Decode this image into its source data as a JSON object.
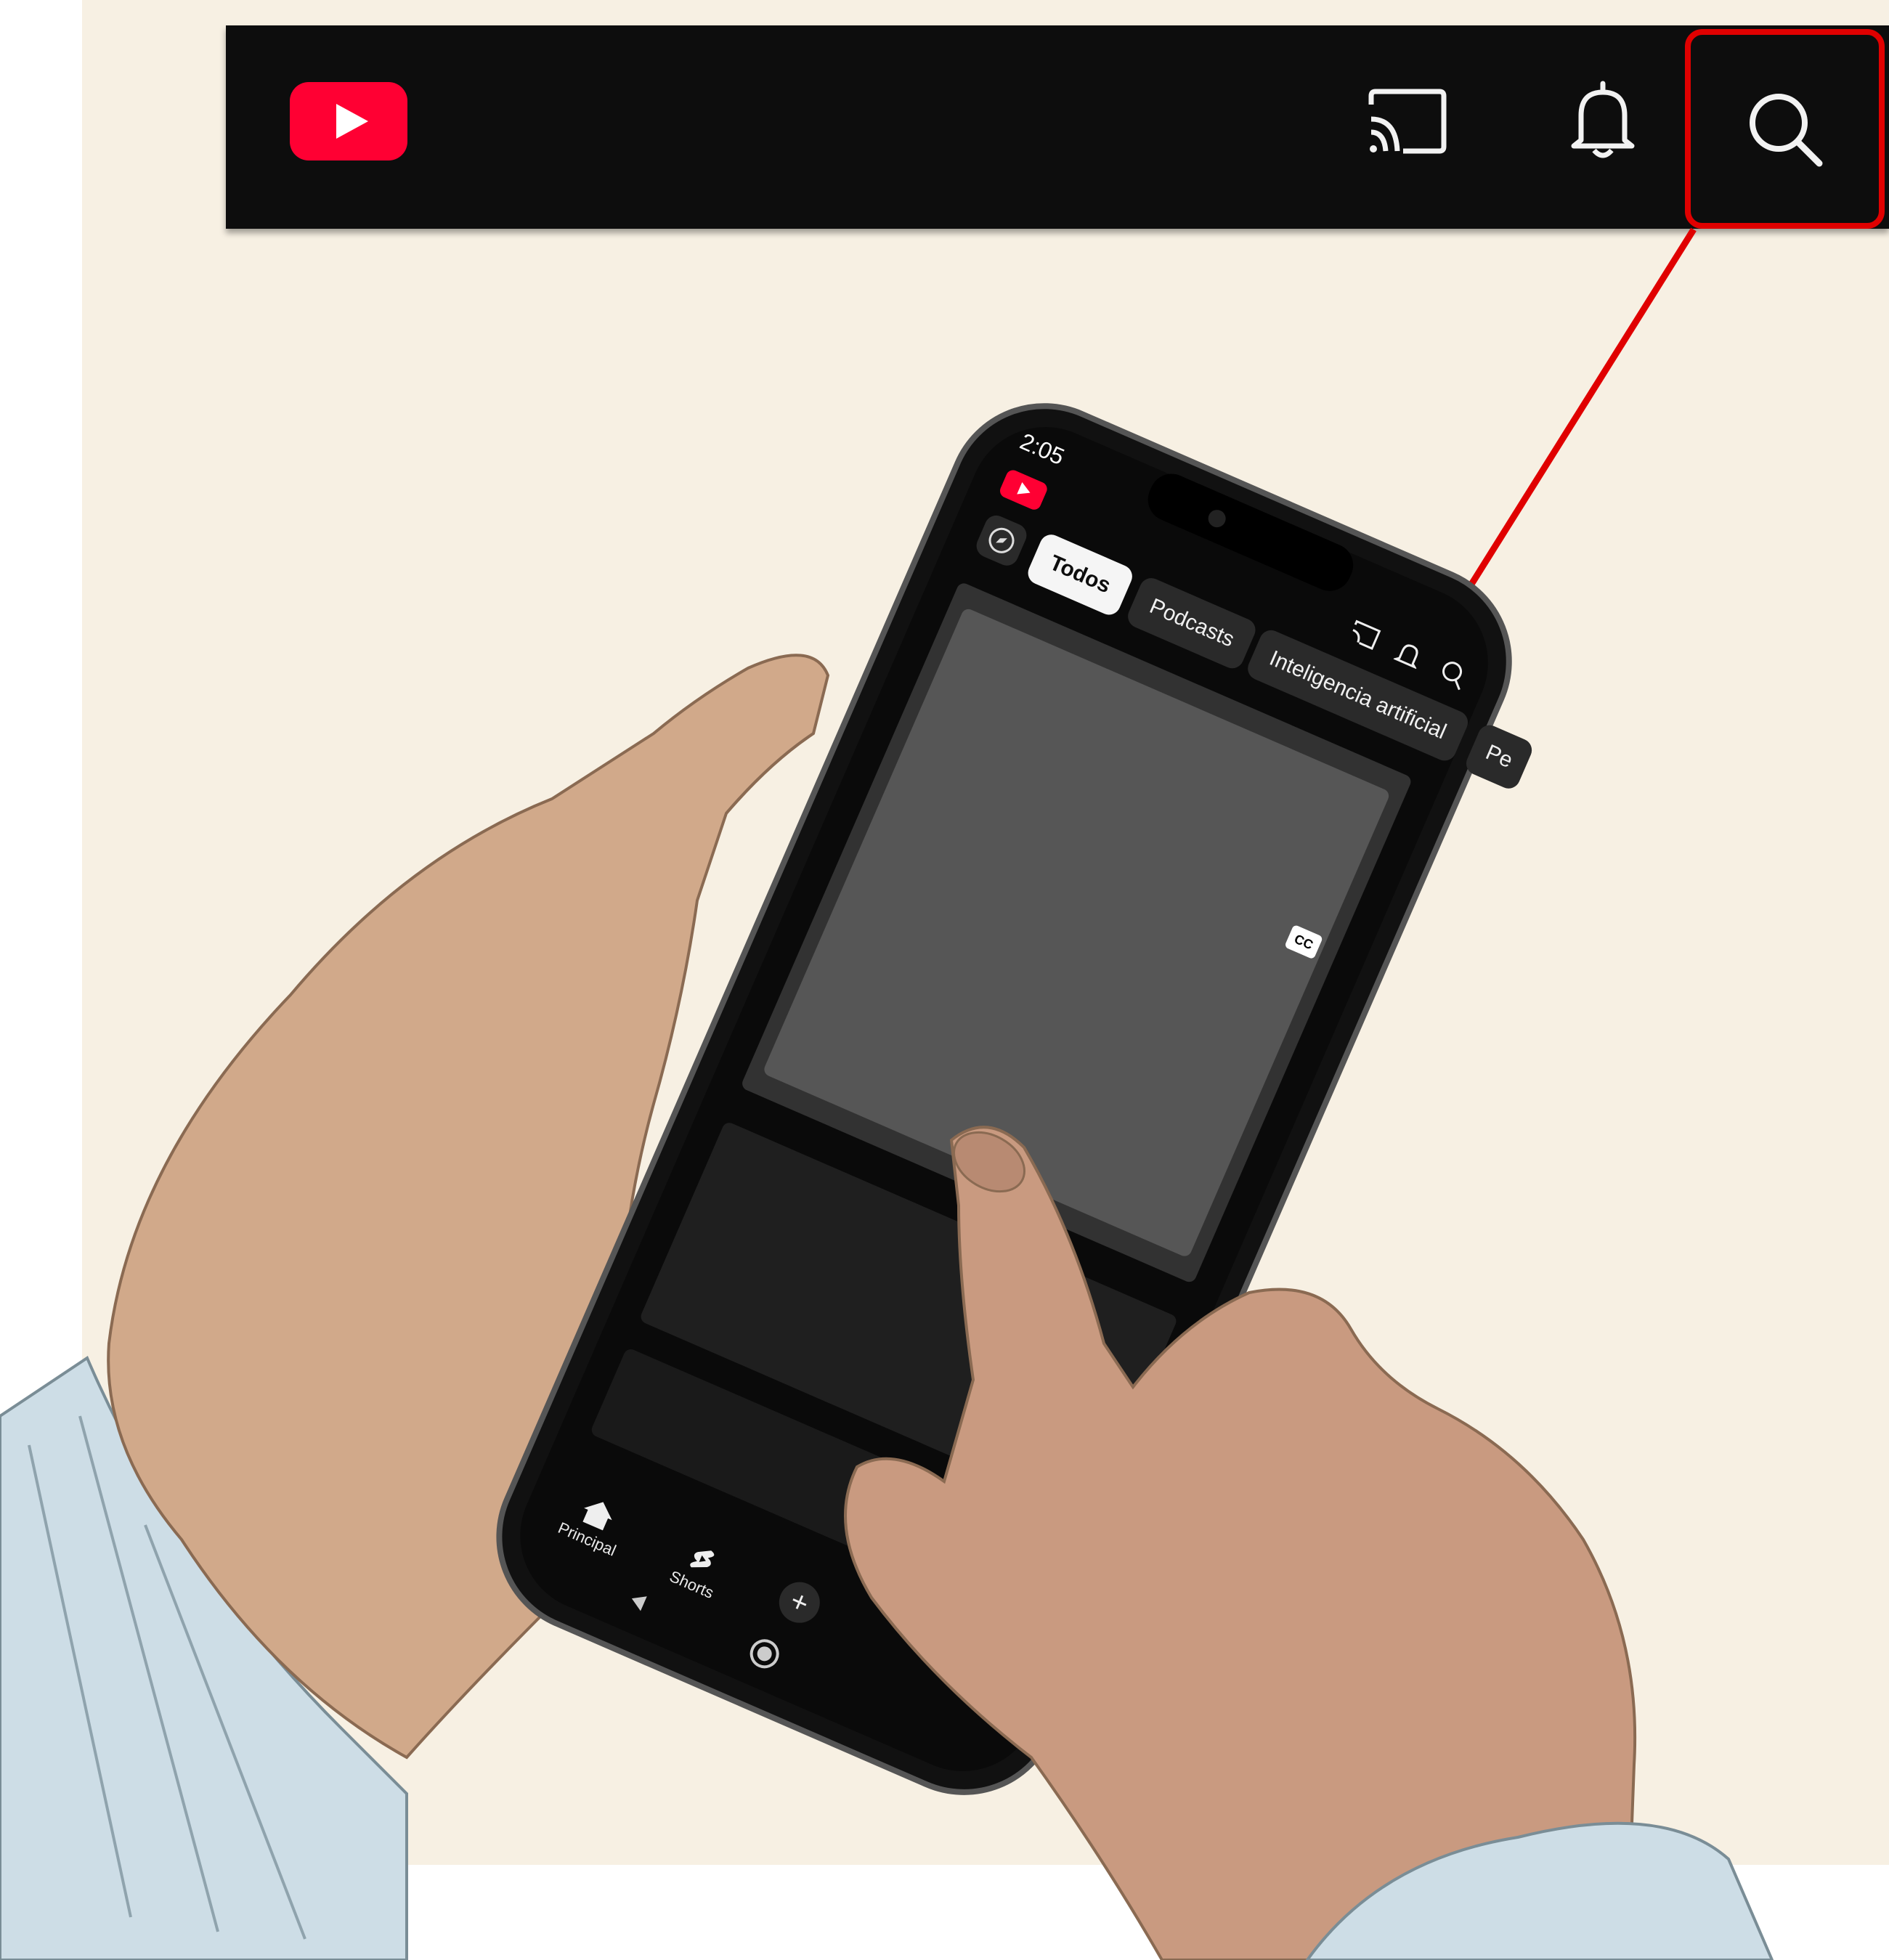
{
  "header": {
    "logo_icon": "youtube-logo-icon",
    "cast_icon": "cast-icon",
    "notifications_icon": "bell-icon",
    "search_icon": "search-icon",
    "highlight_color": "#e00000",
    "brand_color": "#ff0033",
    "bar_color": "#0d0d0d"
  },
  "phone": {
    "status_time": "2:05",
    "chips": [
      {
        "label": "Todos",
        "active": true
      },
      {
        "label": "Podcasts",
        "active": false
      },
      {
        "label": "Inteligencia artificial",
        "active": false
      },
      {
        "label": "Pe",
        "active": false
      }
    ],
    "bottom_nav": {
      "home_label": "Principal",
      "shorts_label": "Shorts"
    },
    "cc_badge": "CC"
  }
}
